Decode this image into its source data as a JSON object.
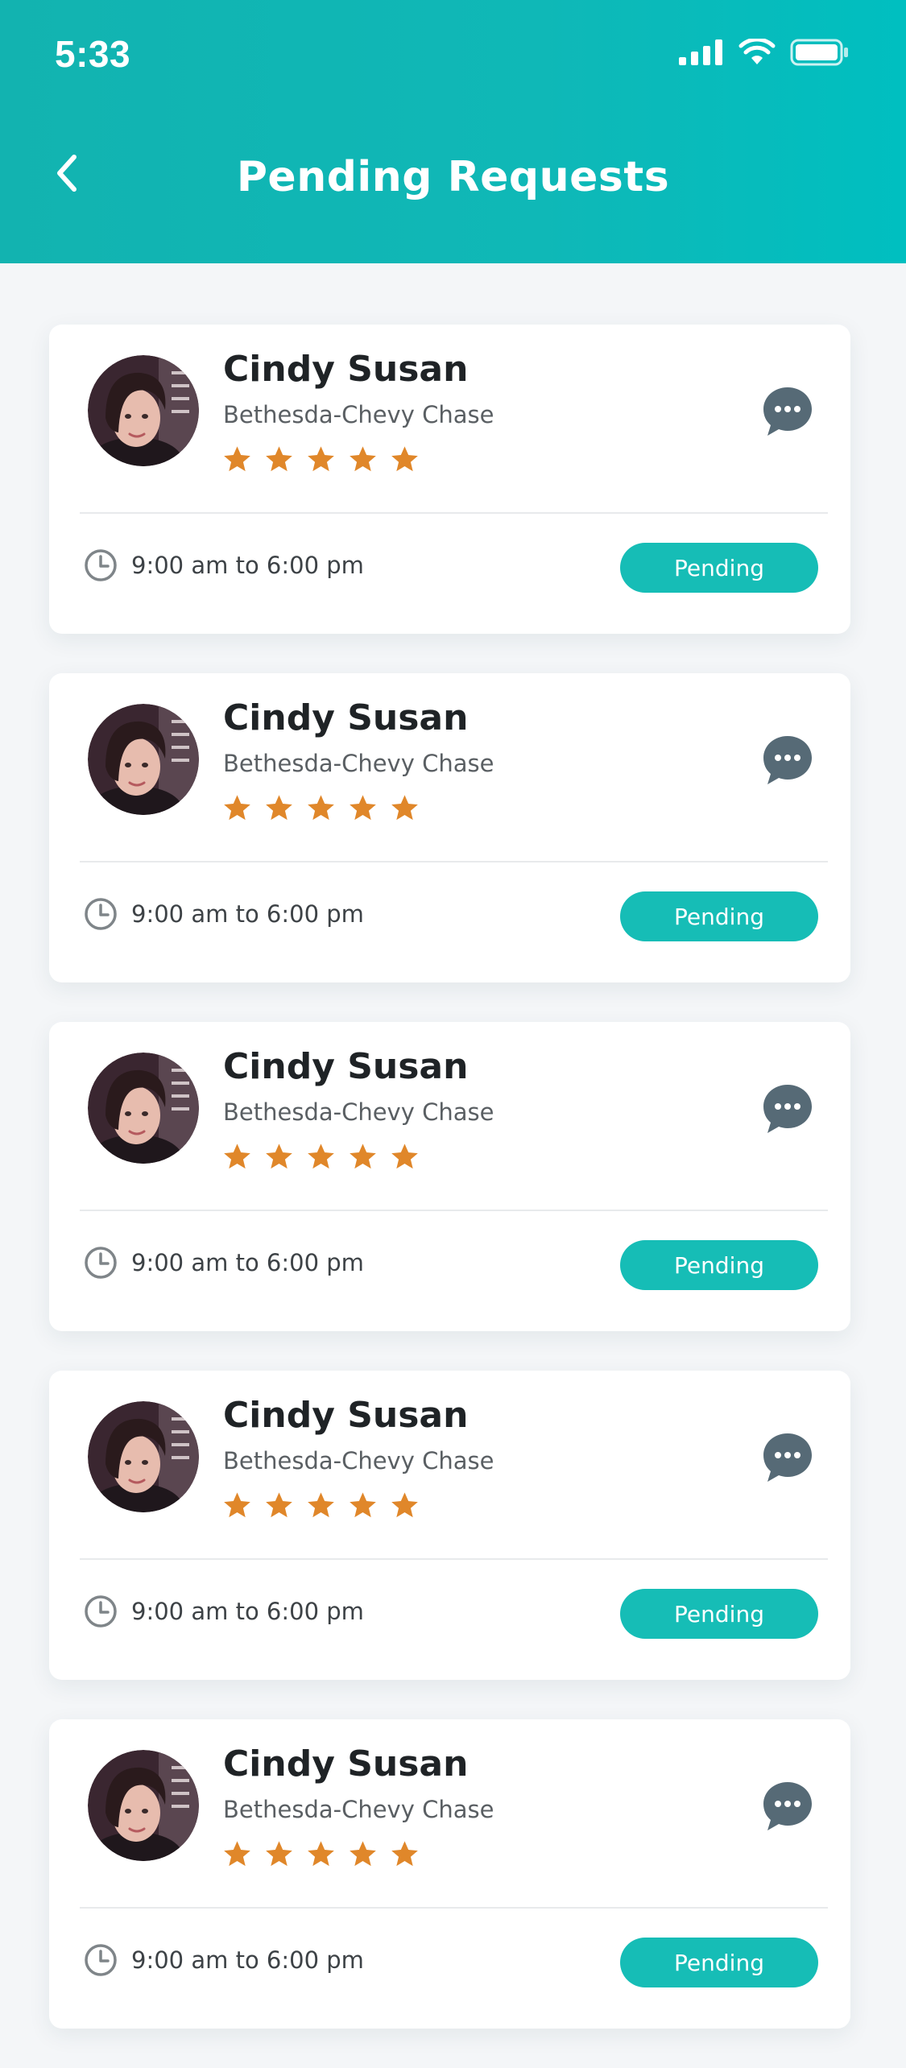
{
  "status_bar": {
    "time": "5:33",
    "icons": [
      "cellular-signal-icon",
      "wifi-icon",
      "battery-icon"
    ]
  },
  "header": {
    "title": "Pending Requests",
    "back_icon": "chevron-left-icon"
  },
  "colors": {
    "header_teal": "#0fb8b7",
    "accent": "#16bdb6",
    "star": "#e0872a",
    "chat_icon": "#566a76",
    "background": "#f4f6f8"
  },
  "requests": [
    {
      "name": "Cindy Susan",
      "location": "Bethesda-Chevy Chase",
      "rating": 5,
      "rating_max": 5,
      "time": "9:00 am to 6:00 pm",
      "status": "Pending"
    },
    {
      "name": "Cindy Susan",
      "location": "Bethesda-Chevy Chase",
      "rating": 5,
      "rating_max": 5,
      "time": "9:00 am to 6:00 pm",
      "status": "Pending"
    },
    {
      "name": "Cindy Susan",
      "location": "Bethesda-Chevy Chase",
      "rating": 5,
      "rating_max": 5,
      "time": "9:00 am to 6:00 pm",
      "status": "Pending"
    },
    {
      "name": "Cindy Susan",
      "location": "Bethesda-Chevy Chase",
      "rating": 5,
      "rating_max": 5,
      "time": "9:00 am to 6:00 pm",
      "status": "Pending"
    },
    {
      "name": "Cindy Susan",
      "location": "Bethesda-Chevy Chase",
      "rating": 5,
      "rating_max": 5,
      "time": "9:00 am to 6:00 pm",
      "status": "Pending"
    }
  ]
}
